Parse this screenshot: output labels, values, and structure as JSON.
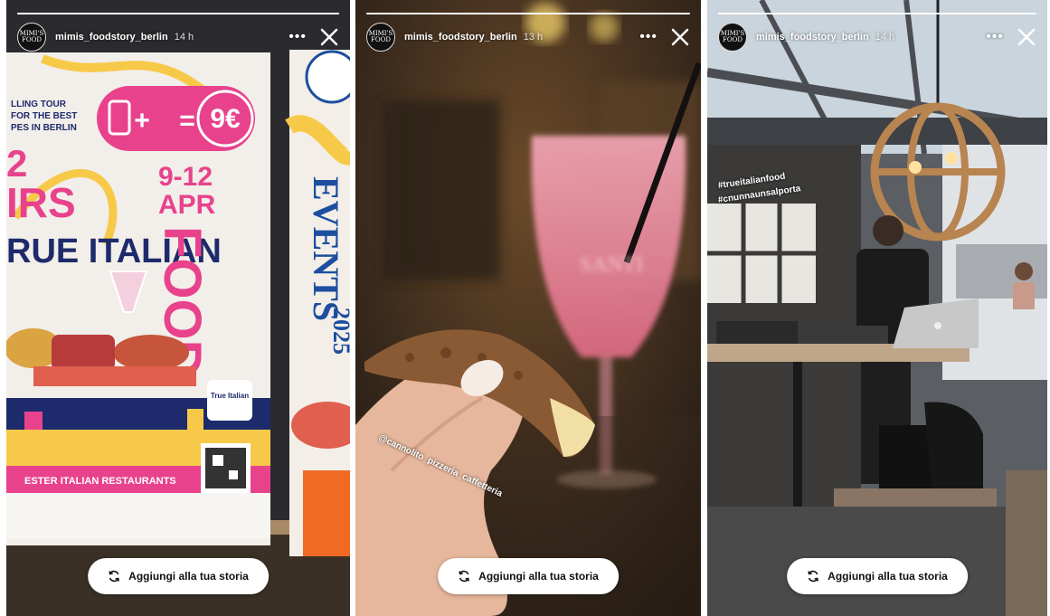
{
  "colors": {
    "poster_pink": "#e8428c",
    "poster_navy": "#1d2a6b",
    "poster_yellow": "#f7c948",
    "drink_pink": "#f08ca0"
  },
  "stories": [
    {
      "username": "mimis_foodstory_berlin",
      "time": "14 h",
      "avatar_text": "MIMI'S FOOD",
      "add_label": "Aggiungi alla tua storia",
      "poster": {
        "line1": "LLING TOUR",
        "line2": "FOR THE BEST",
        "line3": "PES IN BERLIN",
        "price": "9€",
        "plus": "+",
        "equals": "=",
        "big1": "2",
        "big2": "IRS",
        "big3": "RUE ITALIAN",
        "dates": "9-12",
        "month": "APR",
        "food": "FOOD",
        "events": "EVENTS",
        "year": "2025",
        "true_italian": "True Italian",
        "bottom": "ESTER ITALIAN RESTAURANTS"
      }
    },
    {
      "username": "mimis_foodstory_berlin",
      "time": "13 h",
      "avatar_text": "MIMI'S FOOD",
      "add_label": "Aggiungi alla tua storia",
      "glass_text": "SANTI",
      "mention": "@cannolito_pizzeria_caffetteria"
    },
    {
      "username": "mimis_foodstory_berlin",
      "time": "14 h",
      "avatar_text": "MIMI'S FOOD",
      "add_label": "Aggiungi alla tua storia",
      "hashtag1": "#trueitalianfood",
      "hashtag2": "#cnunnaunsalporta"
    }
  ]
}
